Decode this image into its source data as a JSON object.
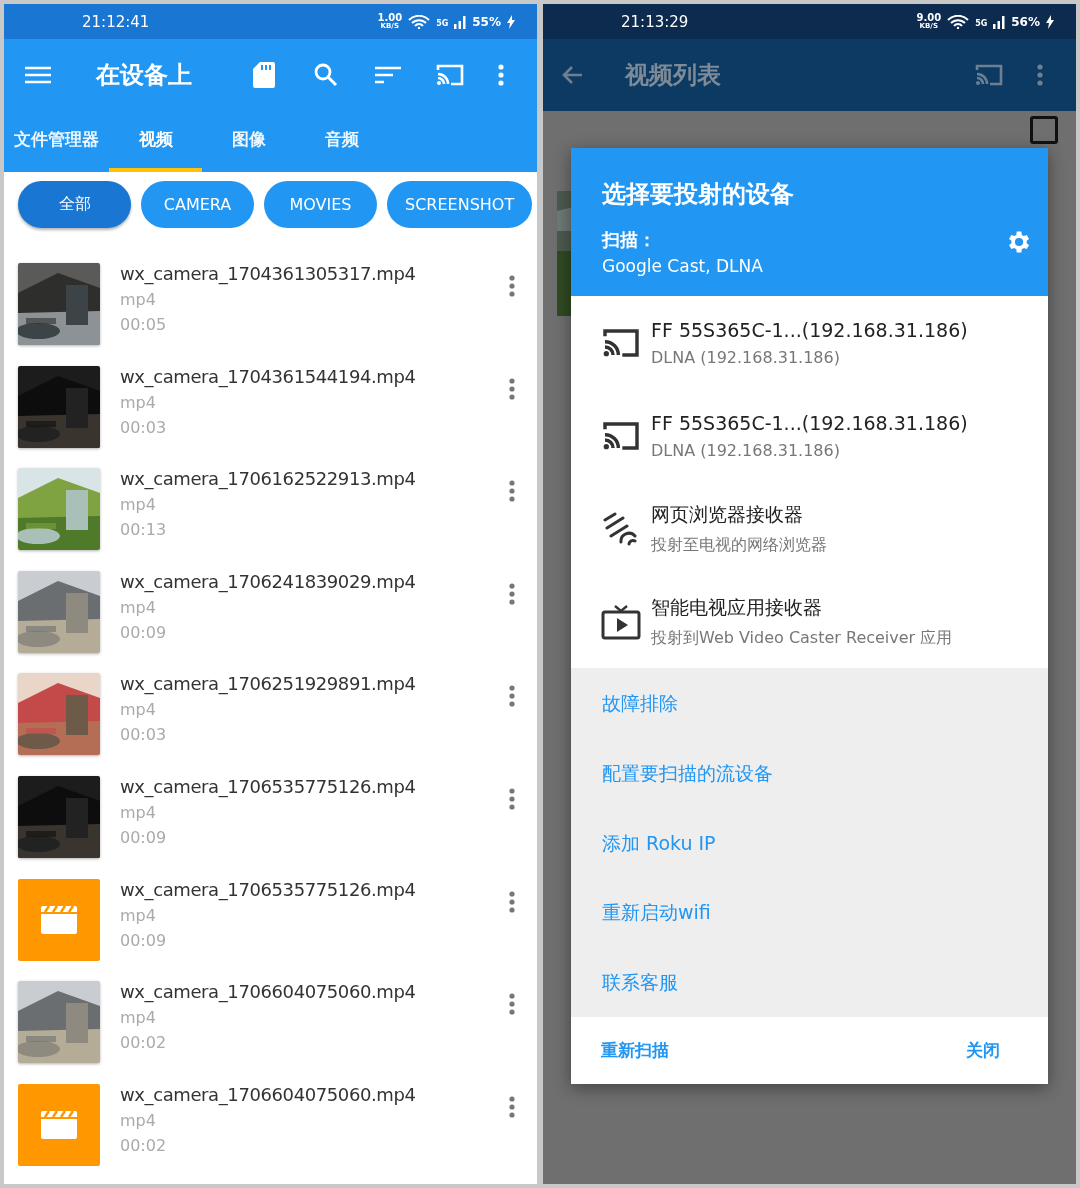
{
  "left": {
    "status_bar": {
      "time": "21:12:41",
      "speed": "1.00",
      "speed_unit": "KB/S",
      "network": "5G",
      "battery": "55%"
    },
    "toolbar": {
      "title": "在设备上"
    },
    "tabs": [
      {
        "label": "文件管理器",
        "selected": false
      },
      {
        "label": "视频",
        "selected": true
      },
      {
        "label": "图像",
        "selected": false
      },
      {
        "label": "音频",
        "selected": false
      }
    ],
    "chips": [
      {
        "label": "全部",
        "selected": true
      },
      {
        "label": "CAMERA",
        "selected": false
      },
      {
        "label": "MOVIES",
        "selected": false
      },
      {
        "label": "SCREENSHOT",
        "selected": false
      }
    ],
    "videos": [
      {
        "name": "wx_camera_1704361305317.mp4",
        "type": "mp4",
        "duration": "00:05",
        "kind": "picture"
      },
      {
        "name": "wx_camera_1704361544194.mp4",
        "type": "mp4",
        "duration": "00:03",
        "kind": "picture"
      },
      {
        "name": "wx_camera_1706162522913.mp4",
        "type": "mp4",
        "duration": "00:13",
        "kind": "picture"
      },
      {
        "name": "wx_camera_1706241839029.mp4",
        "type": "mp4",
        "duration": "00:09",
        "kind": "picture"
      },
      {
        "name": "wx_camera_1706251929891.mp4",
        "type": "mp4",
        "duration": "00:03",
        "kind": "picture"
      },
      {
        "name": "wx_camera_1706535775126.mp4",
        "type": "mp4",
        "duration": "00:09",
        "kind": "picture"
      },
      {
        "name": "wx_camera_1706535775126.mp4",
        "type": "mp4",
        "duration": "00:09",
        "kind": "placeholder"
      },
      {
        "name": "wx_camera_1706604075060.mp4",
        "type": "mp4",
        "duration": "00:02",
        "kind": "picture"
      },
      {
        "name": "wx_camera_1706604075060.mp4",
        "type": "mp4",
        "duration": "00:02",
        "kind": "placeholder"
      }
    ]
  },
  "right": {
    "status_bar": {
      "time": "21:13:29",
      "speed": "9.00",
      "speed_unit": "KB/S",
      "network": "5G",
      "battery": "56%"
    },
    "toolbar": {
      "title": "视频列表"
    },
    "relay_checkbox": {
      "checked": false
    },
    "dialog": {
      "title": "选择要投射的设备",
      "scan_label": "扫描：",
      "scan_value": "Google Cast, DLNA",
      "devices": [
        {
          "kind": "cast",
          "name": "FF 55S365C-1...(192.168.31.186)",
          "detail": "DLNA (192.168.31.186)"
        },
        {
          "kind": "cast",
          "name": "FF 55S365C-1...(192.168.31.186)",
          "detail": "DLNA (192.168.31.186)"
        },
        {
          "kind": "browser",
          "name": "网页浏览器接收器",
          "detail": "投射至电视的网络浏览器"
        },
        {
          "kind": "tv",
          "name": "智能电视应用接收器",
          "detail": "投射到Web Video Caster Receiver 应用"
        }
      ],
      "links": [
        "故障排除",
        "配置要扫描的流设备",
        "添加 Roku IP",
        "重新启动wifi",
        "联系客服"
      ],
      "buttons": [
        "重新扫描",
        "关闭"
      ]
    }
  }
}
